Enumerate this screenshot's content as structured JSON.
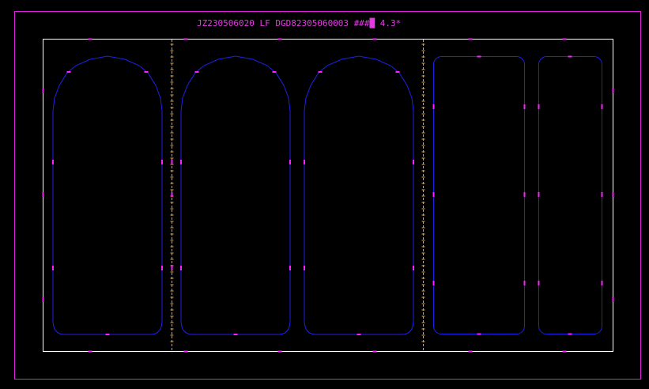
{
  "header": {
    "text": "JZ230506020 LF DGD82305060003 ###█ 4.3*"
  },
  "colors": {
    "background": "#000000",
    "outer_frame": "#e020e0",
    "sheet_border": "#ffffff",
    "panel_outline": "#2020e8",
    "marker": "#ff20ff",
    "cut_line": "#e8a030",
    "title": "#e23be2"
  },
  "panels": [
    {
      "id": "panel-1",
      "shape": "arched-top"
    },
    {
      "id": "panel-2",
      "shape": "arched-top"
    },
    {
      "id": "panel-3",
      "shape": "arched-top"
    },
    {
      "id": "panel-4",
      "shape": "rounded-rectangle"
    },
    {
      "id": "panel-5",
      "shape": "rounded-rectangle"
    }
  ],
  "cut_lines": [
    {
      "id": "cut-line-1",
      "style": "dashed"
    },
    {
      "id": "cut-line-2",
      "style": "dashed"
    }
  ]
}
